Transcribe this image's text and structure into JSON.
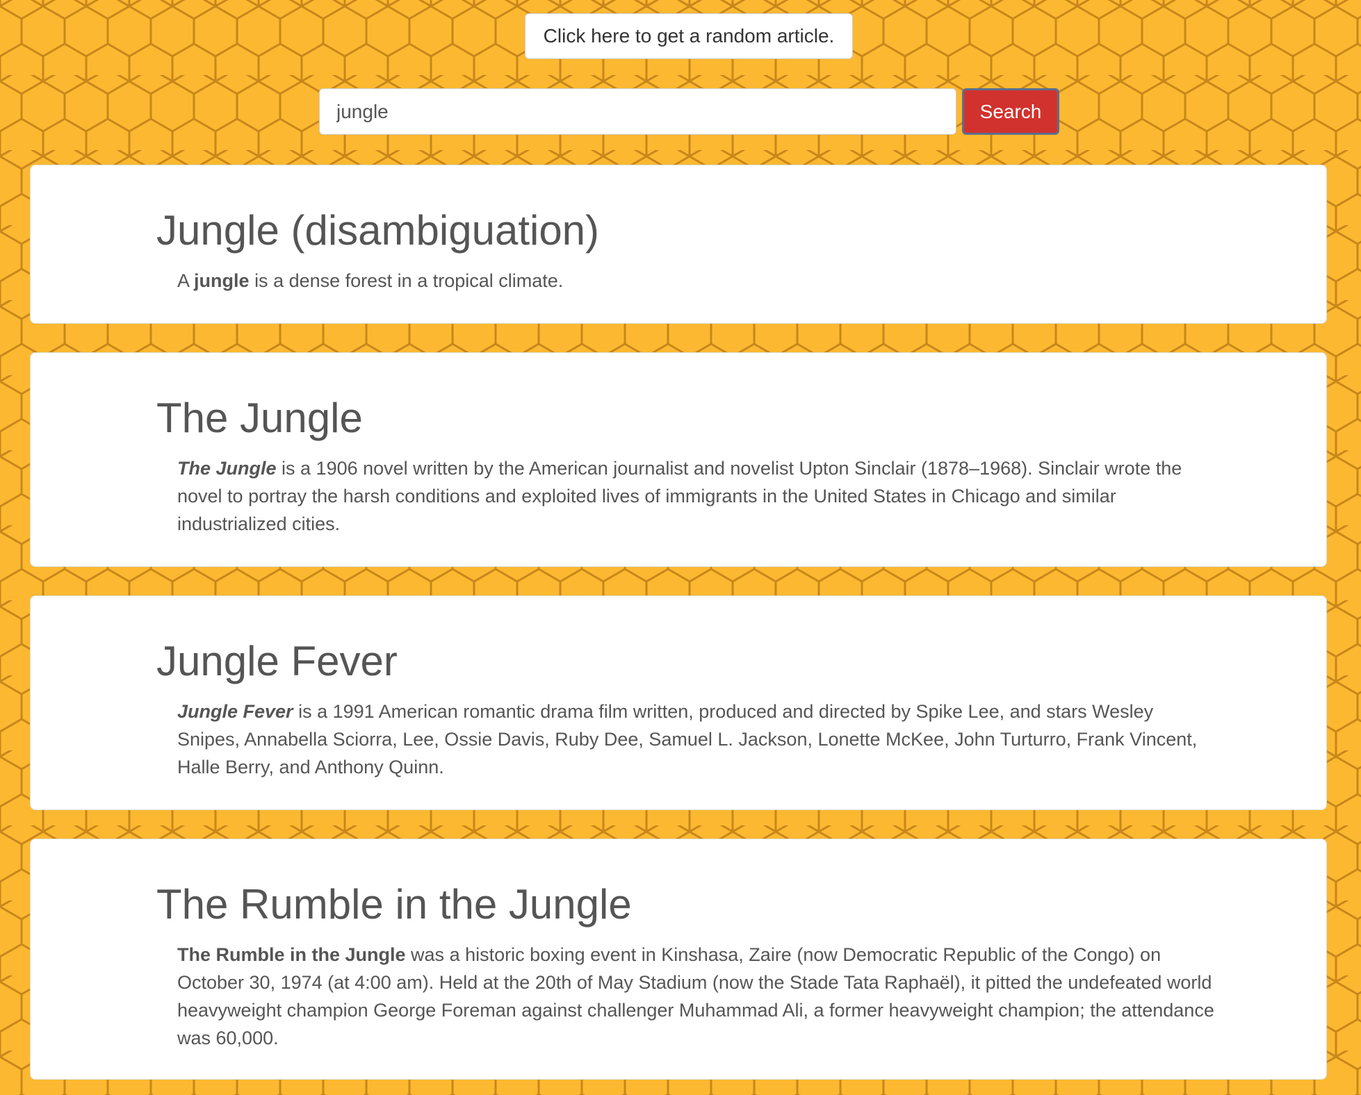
{
  "random_button": {
    "label": "Click here to get a random article."
  },
  "search": {
    "value": "jungle",
    "button_label": "Search"
  },
  "results": [
    {
      "title": "Jungle (disambiguation)",
      "lead": "A",
      "bold": "jungle",
      "rest": "is a dense forest in a tropical climate."
    },
    {
      "title": "The Jungle",
      "lead": "",
      "bold": "The Jungle",
      "rest": "is a 1906 novel written by the American journalist and novelist Upton Sinclair (1878–1968). Sinclair wrote the novel to portray the harsh conditions and exploited lives of immigrants in the United States in Chicago and similar industrialized cities."
    },
    {
      "title": "Jungle Fever",
      "lead": "",
      "bold": "Jungle Fever",
      "rest": "is a 1991 American romantic drama film written, produced and directed by Spike Lee, and stars Wesley Snipes, Annabella Sciorra, Lee, Ossie Davis, Ruby Dee, Samuel L. Jackson, Lonette McKee, John Turturro, Frank Vincent, Halle Berry, and Anthony Quinn."
    },
    {
      "title": "The Rumble in the Jungle",
      "lead": "",
      "bold": "The Rumble in the Jungle",
      "rest": "was a historic boxing event in Kinshasa, Zaire (now Democratic Republic of the Congo) on October 30, 1974 (at 4:00 am). Held at the 20th of May Stadium (now the Stade Tata Raphaël), it pitted the undefeated world heavyweight champion George Foreman against challenger Muhammad Ali, a former heavyweight champion; the attendance was 60,000."
    }
  ],
  "colors": {
    "background": "#fcb830",
    "honeycomb_line": "#c8861b",
    "search_button": "#d2322d",
    "text": "#555555"
  }
}
